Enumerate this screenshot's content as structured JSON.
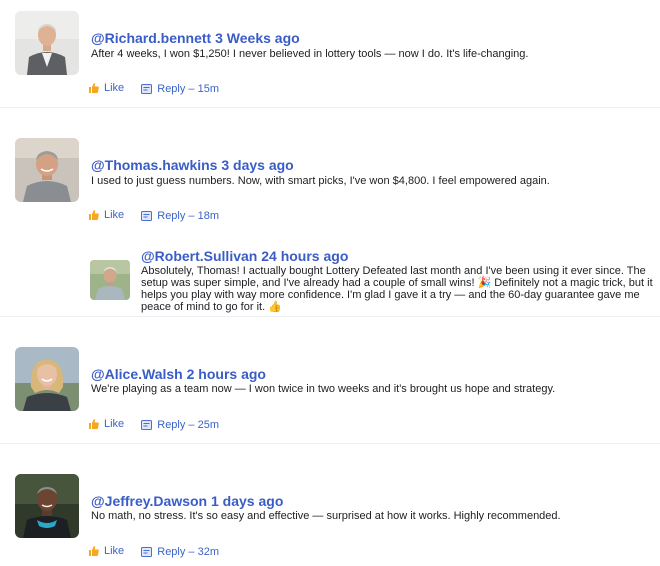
{
  "comments": [
    {
      "username": "@Richard.bennett",
      "time": "3 Weeks ago",
      "text": "After 4 weeks, I won $1,250! I never believed in lottery tools — now I do. It's life-changing.",
      "like_label": "Like",
      "reply_label": "Reply – 15m",
      "avatar_icon": "avatar-richard-photo"
    },
    {
      "username": "@Thomas.hawkins",
      "time": "3 days ago",
      "text": "I used to just guess numbers. Now, with smart picks, I've won $4,800. I feel empowered again.",
      "like_label": "Like",
      "reply_label": "Reply – 18m",
      "avatar_icon": "avatar-thomas-photo",
      "reply": {
        "username": "@Robert.Sullivan",
        "time": "24 hours ago",
        "text": "Absolutely, Thomas! I actually bought Lottery Defeated last month and I've been using it ever since. The setup was super simple, and I've already had a couple of small wins! 🎉 Definitely not a magic trick, but it helps you play with way more confidence. I'm glad I gave it a try — and the 60-day guarantee gave me peace of mind to go for it. 👍",
        "avatar_icon": "avatar-robert-photo"
      }
    },
    {
      "username": "@Alice.Walsh",
      "time": "2 hours ago",
      "text": "We're playing as a team now — I won twice in two weeks and it's brought us hope and strategy.",
      "like_label": "Like",
      "reply_label": "Reply – 25m",
      "avatar_icon": "avatar-alice-photo"
    },
    {
      "username": "@Jeffrey.Dawson",
      "time": "1 days ago",
      "text": "No math, no stress. It's so easy and effective — surprised at how it works. Highly recommended.",
      "like_label": "Like",
      "reply_label": "Reply – 32m",
      "avatar_icon": "avatar-jeffrey-photo"
    }
  ],
  "colors": {
    "username": "#3a5cc7",
    "action_link": "#3b64c8",
    "divider": "#eef0f3",
    "like_icon": "#f5a623"
  }
}
